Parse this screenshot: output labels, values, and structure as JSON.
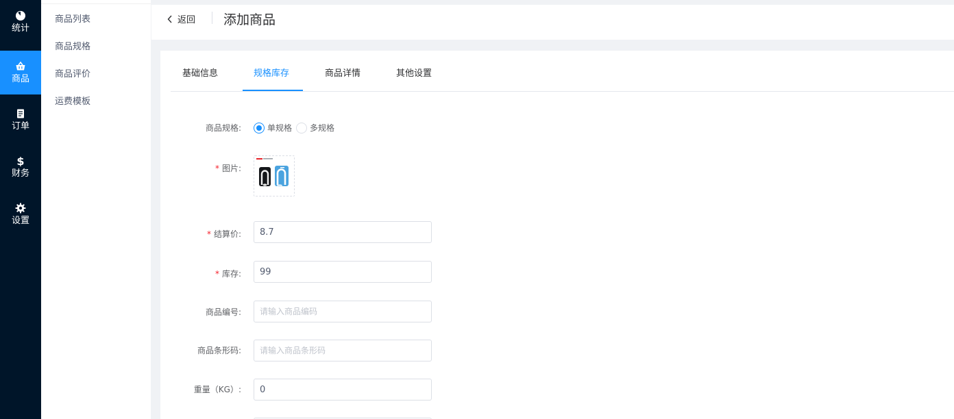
{
  "nav_main": {
    "items": [
      {
        "label": "统计",
        "icon": "pie-chart-icon"
      },
      {
        "label": "商品",
        "icon": "basket-icon"
      },
      {
        "label": "订单",
        "icon": "document-icon"
      },
      {
        "label": "财务",
        "icon": "dollar-icon"
      },
      {
        "label": "设置",
        "icon": "gear-icon"
      }
    ],
    "active_color": "#1890ff",
    "bg_color": "#001529"
  },
  "nav_sub": {
    "items": [
      {
        "label": "商品列表"
      },
      {
        "label": "商品规格"
      },
      {
        "label": "商品评价"
      },
      {
        "label": "运费模板"
      }
    ]
  },
  "header": {
    "back_label": "返回",
    "back_icon": "chevron-left-icon",
    "title": "添加商品"
  },
  "tabs": {
    "items": [
      {
        "label": "基础信息"
      },
      {
        "label": "规格库存"
      },
      {
        "label": "商品详情"
      },
      {
        "label": "其他设置"
      }
    ],
    "active": "规格库存"
  },
  "form": {
    "spec": {
      "label": "商品规格:",
      "options": [
        {
          "label": "单规格",
          "checked": true
        },
        {
          "label": "多规格",
          "checked": false
        }
      ]
    },
    "image": {
      "required_mark": "*",
      "label": "图片:"
    },
    "price": {
      "required_mark": "*",
      "label": "结算价:",
      "value": "8.7"
    },
    "stock": {
      "required_mark": "*",
      "label": "库存:",
      "value": "99"
    },
    "code": {
      "label": "商品编号:",
      "value": "",
      "placeholder": "请输入商品编码"
    },
    "barcode": {
      "label": "商品条形码:",
      "value": "",
      "placeholder": "请输入商品条形码"
    },
    "weight": {
      "label": "重量（KG）:",
      "value": "0"
    }
  },
  "colors": {
    "accent": "#1890ff",
    "required": "#f5222d"
  }
}
